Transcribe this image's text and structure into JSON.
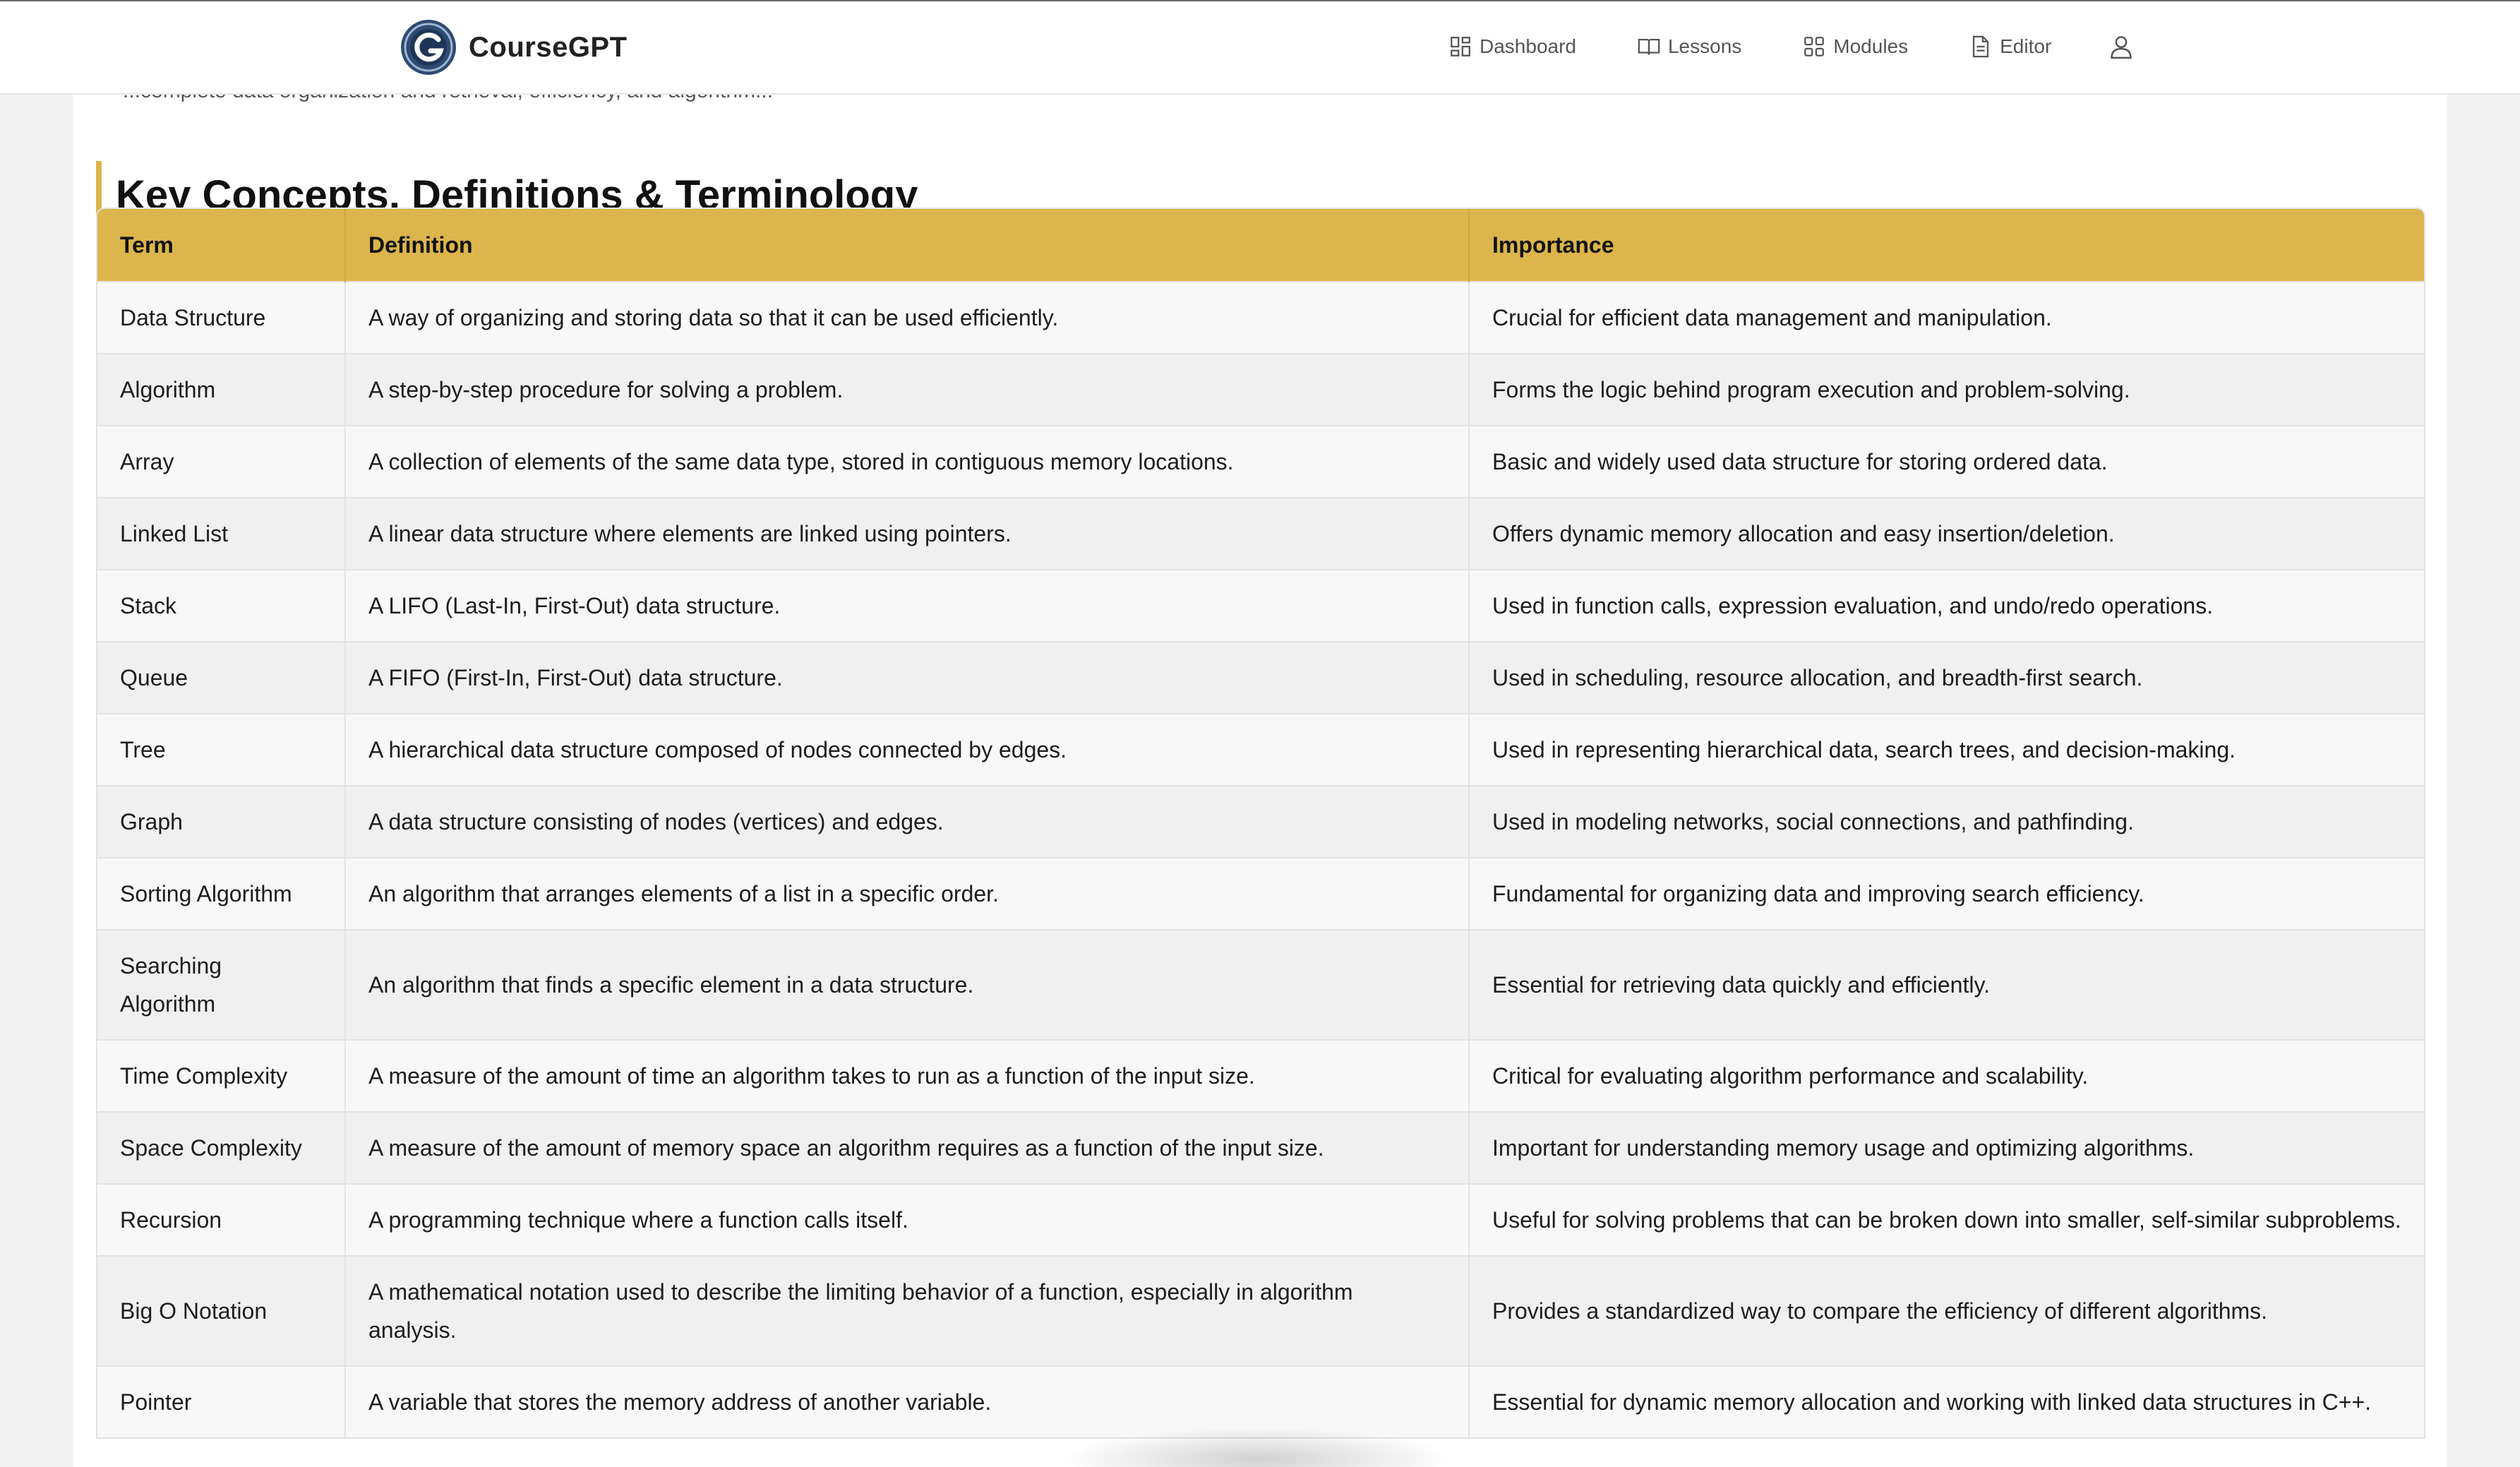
{
  "app": {
    "name": "CourseGPT",
    "logo_letter": "G"
  },
  "nav": {
    "items": [
      {
        "label": "Dashboard",
        "icon": "dashboard-icon"
      },
      {
        "label": "Lessons",
        "icon": "book-icon"
      },
      {
        "label": "Modules",
        "icon": "grid-icon"
      },
      {
        "label": "Editor",
        "icon": "document-icon"
      }
    ],
    "user_icon": "user-icon"
  },
  "content": {
    "peek_text": "...complete data organization and retrieval, efficiency, and algorithm...",
    "section_title": "Key Concepts, Definitions & Terminology",
    "table": {
      "headers": [
        "Term",
        "Definition",
        "Importance"
      ],
      "rows": [
        [
          "Data Structure",
          "A way of organizing and storing data so that it can be used efficiently.",
          "Crucial for efficient data management and manipulation."
        ],
        [
          "Algorithm",
          "A step-by-step procedure for solving a problem.",
          "Forms the logic behind program execution and problem-solving."
        ],
        [
          "Array",
          "A collection of elements of the same data type, stored in contiguous memory locations.",
          "Basic and widely used data structure for storing ordered data."
        ],
        [
          "Linked List",
          "A linear data structure where elements are linked using pointers.",
          "Offers dynamic memory allocation and easy insertion/deletion."
        ],
        [
          "Stack",
          "A LIFO (Last-In, First-Out) data structure.",
          "Used in function calls, expression evaluation, and undo/redo operations."
        ],
        [
          "Queue",
          "A FIFO (First-In, First-Out) data structure.",
          "Used in scheduling, resource allocation, and breadth-first search."
        ],
        [
          "Tree",
          "A hierarchical data structure composed of nodes connected by edges.",
          "Used in representing hierarchical data, search trees, and decision-making."
        ],
        [
          "Graph",
          "A data structure consisting of nodes (vertices) and edges.",
          "Used in modeling networks, social connections, and pathfinding."
        ],
        [
          "Sorting Algorithm",
          "An algorithm that arranges elements of a list in a specific order.",
          "Fundamental for organizing data and improving search efficiency."
        ],
        [
          "Searching Algorithm",
          "An algorithm that finds a specific element in a data structure.",
          "Essential for retrieving data quickly and efficiently."
        ],
        [
          "Time Complexity",
          "A measure of the amount of time an algorithm takes to run as a function of the input size.",
          "Critical for evaluating algorithm performance and scalability."
        ],
        [
          "Space Complexity",
          "A measure of the amount of memory space an algorithm requires as a function of the input size.",
          "Important for understanding memory usage and optimizing algorithms."
        ],
        [
          "Recursion",
          "A programming technique where a function calls itself.",
          "Useful for solving problems that can be broken down into smaller, self-similar subproblems."
        ],
        [
          "Big O Notation",
          "A mathematical notation used to describe the limiting behavior of a function, especially in algorithm analysis.",
          "Provides a standardized way to compare the efficiency of different algorithms."
        ],
        [
          "Pointer",
          "A variable that stores the memory address of another variable.",
          "Essential for dynamic memory allocation and working with linked data structures in C++."
        ]
      ]
    }
  },
  "colors": {
    "accent": "#dcb54c",
    "header_bg": "#ffffff",
    "page_bg": "#f3f3f3"
  }
}
